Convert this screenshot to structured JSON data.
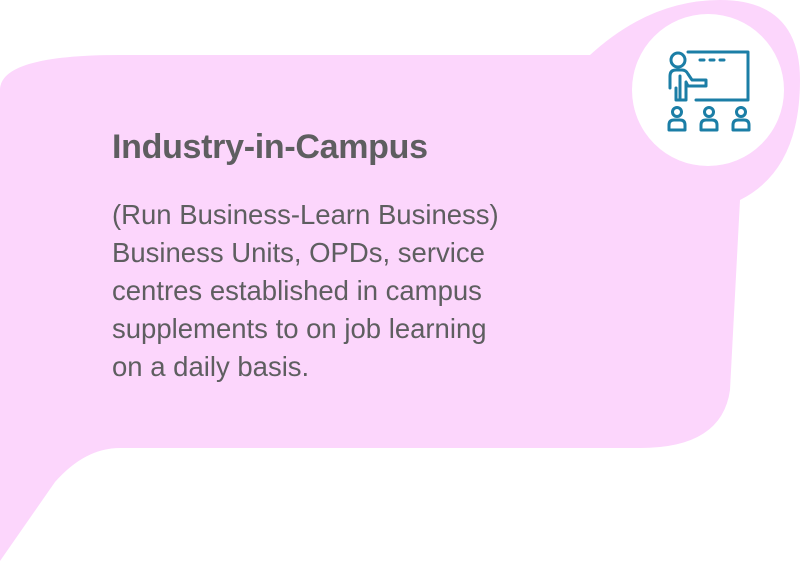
{
  "card": {
    "title": "Industry-in-Campus",
    "lines": [
      "(Run Business-Learn Business)",
      "Business Units, OPDs, service",
      "centres established in campus",
      "supplements to on job learning",
      "on a daily basis."
    ]
  },
  "badge": {
    "icon": "presentation-icon"
  },
  "colors": {
    "card_background": "#fcd6fc",
    "badge_background": "#ffffff",
    "icon": "#1b7ea6",
    "text": "#5e5e60"
  }
}
